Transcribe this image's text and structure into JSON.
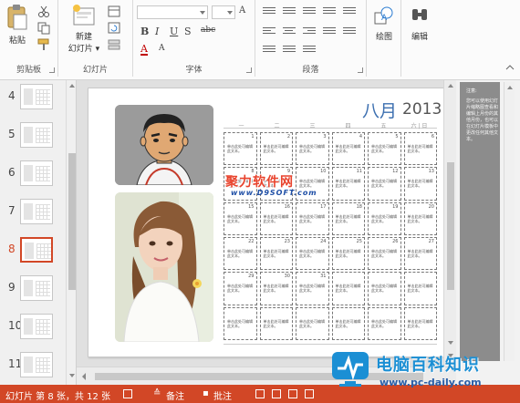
{
  "ribbon": {
    "groups": {
      "clipboard": "剪贴板",
      "slides": "幻灯片",
      "font": "字体",
      "paragraph": "段落"
    },
    "buttons": {
      "paste": "粘贴",
      "new_slide": "新建",
      "new_slide_sub": "幻灯片 ▾",
      "drawing": "绘图",
      "editing": "编辑"
    },
    "font_format": {
      "bold": "B",
      "italic": "I",
      "underline": "U",
      "strike": "S",
      "strike2": "abc",
      "font_color": "A",
      "grow": "A",
      "shrink": "A"
    },
    "icons": [
      "cut-icon",
      "copy-icon",
      "format-painter-icon",
      "layout-icon",
      "reset-icon",
      "section-icon",
      "bullets-icon",
      "numbering-icon",
      "align-icon",
      "shapes-icon",
      "find-icon"
    ]
  },
  "thumbnails": {
    "items": [
      {
        "number": "4",
        "selected": false
      },
      {
        "number": "5",
        "selected": false
      },
      {
        "number": "6",
        "selected": false
      },
      {
        "number": "7",
        "selected": false
      },
      {
        "number": "8",
        "selected": true
      },
      {
        "number": "9",
        "selected": false
      },
      {
        "number": "10",
        "selected": false
      },
      {
        "number": "11",
        "selected": false
      }
    ]
  },
  "slide": {
    "month": "八月",
    "year": "2013",
    "weekdays": [
      "一",
      "二",
      "三",
      "四",
      "五",
      "六 | 日"
    ],
    "cell_hint": "单击此处可编辑此文本。",
    "days": [
      [
        "1",
        "2",
        "3",
        "4",
        "5",
        "6"
      ],
      [
        "8",
        "9",
        "10",
        "11",
        "12",
        "13"
      ],
      [
        "15",
        "16",
        "17",
        "18",
        "19",
        "20"
      ],
      [
        "22",
        "23",
        "24",
        "25",
        "26",
        "27"
      ],
      [
        "29",
        "30",
        "31",
        "",
        "",
        ""
      ],
      [
        "",
        "",
        "",
        "",
        "",
        ""
      ]
    ]
  },
  "watermark": {
    "line1": "聚力软件网",
    "line2": "www.D9SOFT.com"
  },
  "taskpane": {
    "title": "注意:",
    "body": "您可以使用幻灯片缩略图查看和编辑上月份的其他月份，也可以在幻灯片模板中更改任何其他文本。"
  },
  "status": {
    "slide_info": "幻灯片 第 8 张，共 12 张",
    "notes": "备注",
    "comments": "批注"
  },
  "site_logo": {
    "name": "电脑百科知识",
    "url": "www.pc-daily.com"
  },
  "colors": {
    "accent": "#d24726",
    "calendar_title": "#3c6fb0",
    "watermark_red": "#e8432d",
    "watermark_blue": "#1f4fa6",
    "logo_blue": "#1b8fd4"
  }
}
